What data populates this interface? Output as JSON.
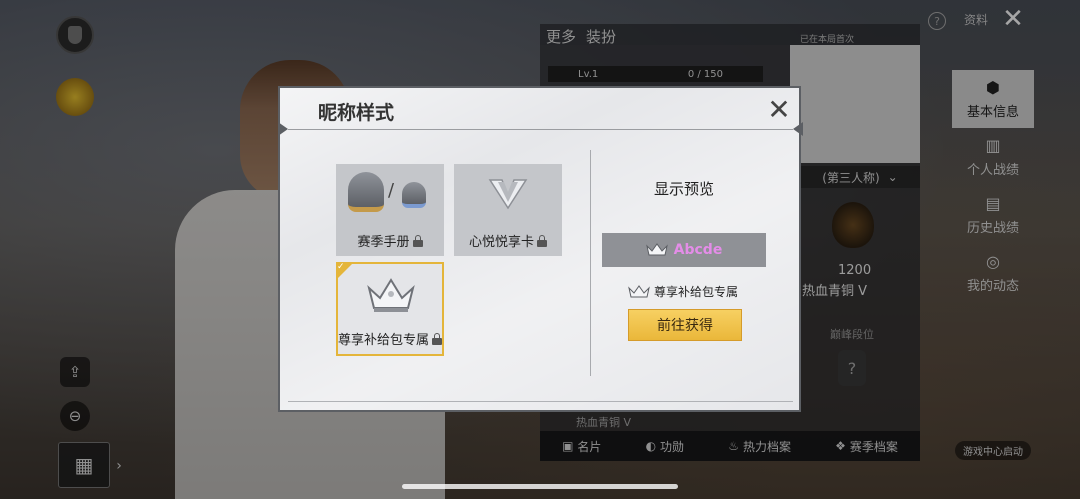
{
  "background": {
    "top_tabs": [
      "更多",
      "装扮"
    ],
    "top_note": "已在本局首次",
    "level": "Lv.1",
    "progress": "0 / 150",
    "mode": "(第三人称)",
    "rank_score": "1200",
    "rank_name": "热血青铜 V",
    "rank_label": "巅峰段位",
    "rank_unknown": "?",
    "hot_label": "热血青铜 V",
    "bottom_tabs": [
      "名片",
      "功勋",
      "热力档案",
      "赛季档案"
    ],
    "sidebar_items": [
      {
        "label": "基本信息",
        "icon": "⬢"
      },
      {
        "label": "个人战绩",
        "icon": "▥"
      },
      {
        "label": "历史战绩",
        "icon": "▤"
      },
      {
        "label": "我的动态",
        "icon": "◎"
      }
    ],
    "top_right_tab": "资料",
    "close_glyph": "✕",
    "help_glyph": "?",
    "game_center": "游戏中心启动"
  },
  "modal": {
    "title": "昵称样式",
    "close_glyph": "✕",
    "cards": [
      {
        "label": "赛季手册",
        "icon": "helmet-icon",
        "locked": true
      },
      {
        "label": "心悦悦享卡",
        "icon": "v-icon",
        "locked": true
      },
      {
        "label": "尊享补给包专属",
        "icon": "crown-icon",
        "locked": true,
        "selected": true
      }
    ],
    "slash": "/",
    "check": "✓",
    "preview_title": "显示预览",
    "preview_name": "Abcde",
    "exclusive_note": "尊享补给包专属",
    "go_button": "前往获得"
  },
  "colors": {
    "accent_gold": "#e4b53a",
    "preview_name_pink": "#e48de8",
    "modal_bg": "#e6e7ea"
  }
}
